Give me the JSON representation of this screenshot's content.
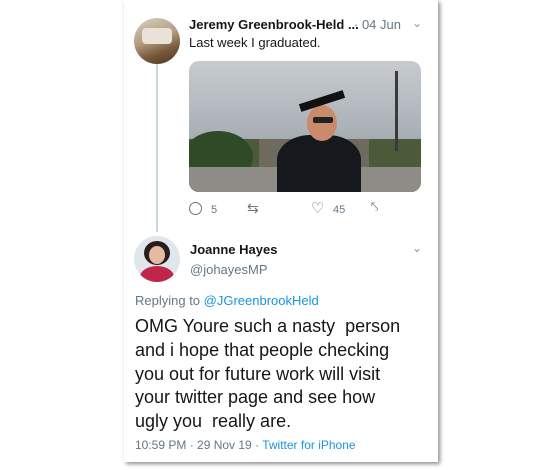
{
  "tweet1": {
    "author_name": "Jeremy Greenbrook-Held ...",
    "date": "· 04 Jun",
    "text": "Last week I graduated.",
    "photo_alt": "graduation photo",
    "reply_count": "5",
    "retweet_count": "",
    "like_count": "45"
  },
  "tweet2": {
    "author_name": "Joanne Hayes",
    "handle": "@johayesMP",
    "replying_prefix": "Replying to ",
    "replying_handle": "@JGreenbrookHeld",
    "text": "OMG Youre such a nasty  person\nand i hope that people checking\nyou out for future work will visit\nyour twitter page and see how\nugly you  really are.",
    "time_date": "10:59 PM · 29 Nov 19 · ",
    "source": "Twitter for iPhone"
  },
  "icons": {
    "reply": "reply-icon",
    "retweet": "retweet-icon",
    "like": "heart-icon",
    "share": "share-icon",
    "menu": "chevron-down-icon"
  },
  "colors": {
    "link": "#1b95e0",
    "secondary_text": "#657786",
    "thread_line": "#ccd6dd"
  }
}
